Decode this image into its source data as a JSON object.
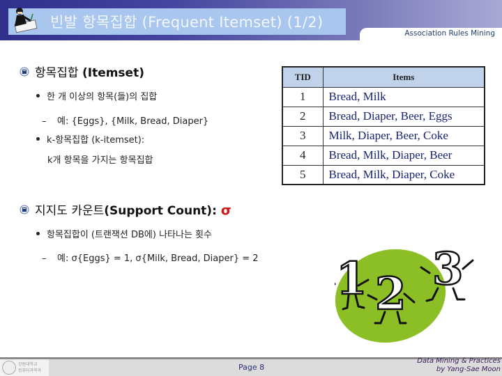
{
  "header": {
    "title": "빈발 항목집합 (Frequent Itemset) (1/2)",
    "subtitle": "Association Rules Mining",
    "icon": "presenter-writing-icon"
  },
  "content": {
    "section1": {
      "icon": "emblem-bullet-icon",
      "title_ko": "항목집합",
      "title_en": "(Itemset)",
      "bullet1": "한 개 이상의 항목(들)의 집합",
      "example1": "예: {Eggs}, {Milk, Bread, Diaper}",
      "bullet2": "k-항목집합 (k-itemset):",
      "bullet2_cont": "k개 항목을 가지는 항목집합"
    },
    "section2": {
      "icon": "emblem-bullet-icon",
      "title_ko": "지지도 카운트",
      "title_en": "(Support Count):",
      "symbol": "σ",
      "symbol_color": "#d01818",
      "bullet1": "항목집합이 (트랜잭션 DB에) 나타나는 횟수",
      "example1": "예: σ{Eggs} = 1, σ{Milk, Bread, Diaper} = 2"
    }
  },
  "table": {
    "headers": [
      "TID",
      "Items"
    ],
    "rows": [
      {
        "tid": "1",
        "items": "Bread, Milk"
      },
      {
        "tid": "2",
        "items": "Bread, Diaper, Beer, Eggs"
      },
      {
        "tid": "3",
        "items": "Milk, Diaper, Beer, Coke"
      },
      {
        "tid": "4",
        "items": "Bread, Milk, Diaper, Beer"
      },
      {
        "tid": "5",
        "items": "Bread, Milk, Diaper, Coke"
      }
    ],
    "header_bg": "#c0d3ea"
  },
  "clipart": {
    "digits": [
      "1",
      "2",
      "3"
    ],
    "blob_color": "#8cbf26"
  },
  "footer": {
    "logo_text_line1": "강원대학교",
    "logo_text_line2": "컴퓨터과학과",
    "page": "Page 8",
    "credit_line1": "Data Mining & Practices",
    "credit_line2": "by Yang-Sae Moon"
  }
}
